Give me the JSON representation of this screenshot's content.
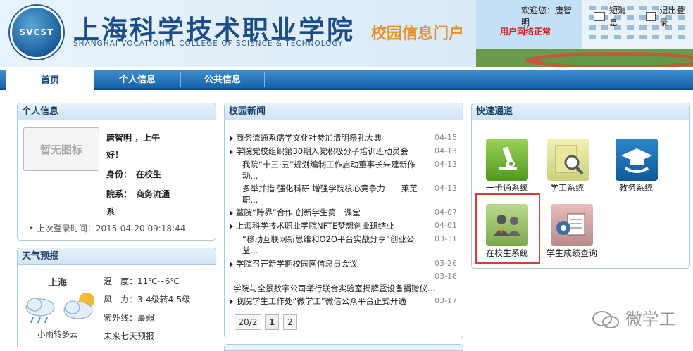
{
  "header": {
    "logo_text": "SVCST",
    "school_name_cn": "上海科学技术职业学院",
    "school_name_en": "SHANGHAI VOCATIONAL COLLEGE OF SCIENCE & TECHNOLOGY",
    "portal_title": "校园信息门户",
    "welcome": "欢迎您：唐智明",
    "messages_label": "短消息",
    "logout_label": "退出登录",
    "network_status": "用户网络正常"
  },
  "nav": {
    "tabs": [
      {
        "label": "首页"
      },
      {
        "label": "个人信息"
      },
      {
        "label": "公共信息"
      }
    ]
  },
  "personal": {
    "title": "个人信息",
    "avatar_placeholder": "暂无图标",
    "greeting_line1": "唐智明 ，上午",
    "greeting_line2": "好！",
    "identity_label": "身份：",
    "identity_value": "在校生",
    "dept_label": "院系：",
    "dept_value": "商务流通",
    "dept_value_cont": "系",
    "last_login": "上次登录时间：2015-04-20 09:18:44"
  },
  "weather": {
    "title": "天气预报",
    "city": "上海",
    "condition": "小雨转多云",
    "temp": "温　度：11℃~6℃",
    "wind": "风　力：3-4级转4-5级",
    "uv": "紫外线：最弱",
    "forecast_link": "未来七天预报"
  },
  "news": {
    "title": "校园新闻",
    "items": [
      {
        "text": "商务流通系儒学文化社参加清明祭孔大典",
        "date": "04-15"
      },
      {
        "text": "学院党校组织第30期入党积极分子培训班动员会",
        "date": "04-13"
      },
      {
        "text": "我院“十三·五”规划编制工作启动董事长朱建新作",
        "date": "04-13",
        "cont": "动..."
      },
      {
        "text": "多举并措  强化科研  增强学院核心竞争力——莱芜",
        "date": "04-13",
        "cont": "职..."
      },
      {
        "text": "鳘院“跨界”合作  创新学生第二课堂",
        "date": "04-07"
      },
      {
        "text": "上海科学技术职业学院NFTE梦想创业班结业",
        "date": "04-01"
      },
      {
        "text": "“移动互联网新思维和O2O平台实战分享”创业公",
        "date": "03-31",
        "cont": "益..."
      },
      {
        "text": "学院召开新学期校园网信息员会议",
        "date": "03-26"
      },
      {
        "text": "学院与全景数字公司举行联合实验室揭牌暨设备捐赠仪...",
        "date": "03-18"
      },
      {
        "text": "我院学生工作处“微学工”微信公众平台正式开通",
        "date": "03-17"
      }
    ],
    "pager_info": "20/2",
    "pages": [
      "1",
      "2"
    ]
  },
  "quick": {
    "title": "快速通道",
    "apps": [
      {
        "label": "一卡通系统",
        "icon": "microscope-icon"
      },
      {
        "label": "学工系统",
        "icon": "magnifier-folder-icon"
      },
      {
        "label": "教务系统",
        "icon": "graduation-cap-icon"
      },
      {
        "label": "在校生系统",
        "icon": "students-icon"
      },
      {
        "label": "学生成绩查询",
        "icon": "report-card-icon"
      }
    ]
  },
  "watermark": "微学工",
  "colors": {
    "brand_blue": "#1862a8",
    "accent_orange": "#e8902a",
    "status_red": "#d81c1c",
    "highlight_red": "#d93a3a"
  }
}
